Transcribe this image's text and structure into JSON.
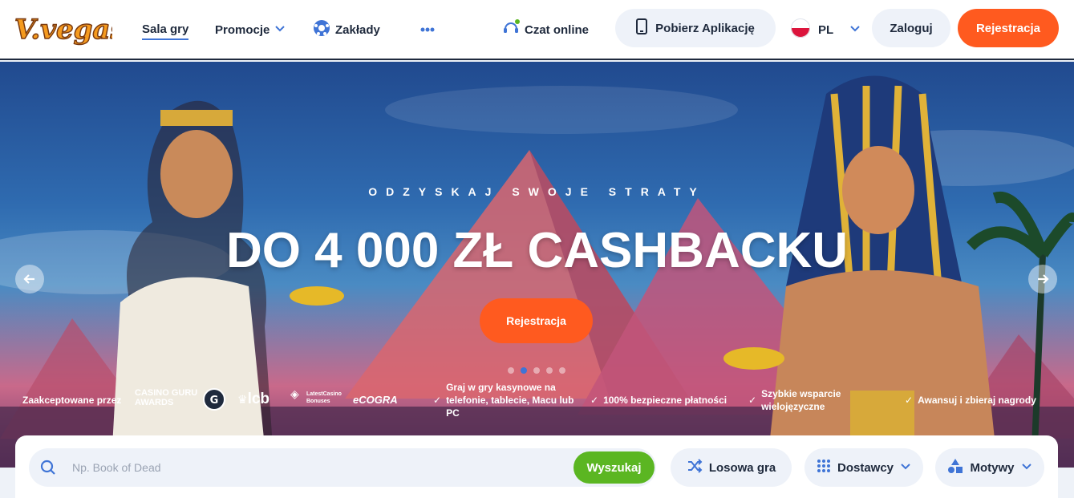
{
  "brand": {
    "logo_text": "V.vegas"
  },
  "nav": {
    "items": [
      {
        "label": "Sala gry"
      },
      {
        "label": "Promocje"
      },
      {
        "label": "Zakłady"
      }
    ],
    "more_icon": "more-dots-icon"
  },
  "header": {
    "chat_label": "Czat online",
    "download_label": "Pobierz Aplikację",
    "language": "PL",
    "login_label": "Zaloguj",
    "register_label": "Rejestracja"
  },
  "hero": {
    "subtitle": "ODZYSKAJ SWOJE STRATY",
    "title": "DO 4 000 ZŁ CASHBACKU",
    "cta_label": "Rejestracja",
    "slides_count": 5,
    "active_slide": 2
  },
  "trust": {
    "accepted_label": "Zaakceptowane przez",
    "partners": [
      "CASINO GURU AWARDS",
      "lcb",
      "LatestCasino Bonuses",
      "eCOGRA"
    ],
    "features": [
      "Graj w gry kasynowe na telefonie, tablecie, Macu lub PC",
      "100% bezpieczne płatności",
      "Szybkie wsparcie wielojęzyczne",
      "Awansuj i zbieraj nagrody"
    ]
  },
  "search": {
    "placeholder": "Np. Book of Dead",
    "value": "",
    "button_label": "Wyszukaj",
    "random_label": "Losowa gra",
    "providers_label": "Dostawcy",
    "themes_label": "Motywy"
  },
  "colors": {
    "accent_orange": "#ff5a1f",
    "accent_green": "#5bb622",
    "accent_blue": "#3f74d6",
    "text_dark": "#1f2a3d"
  }
}
